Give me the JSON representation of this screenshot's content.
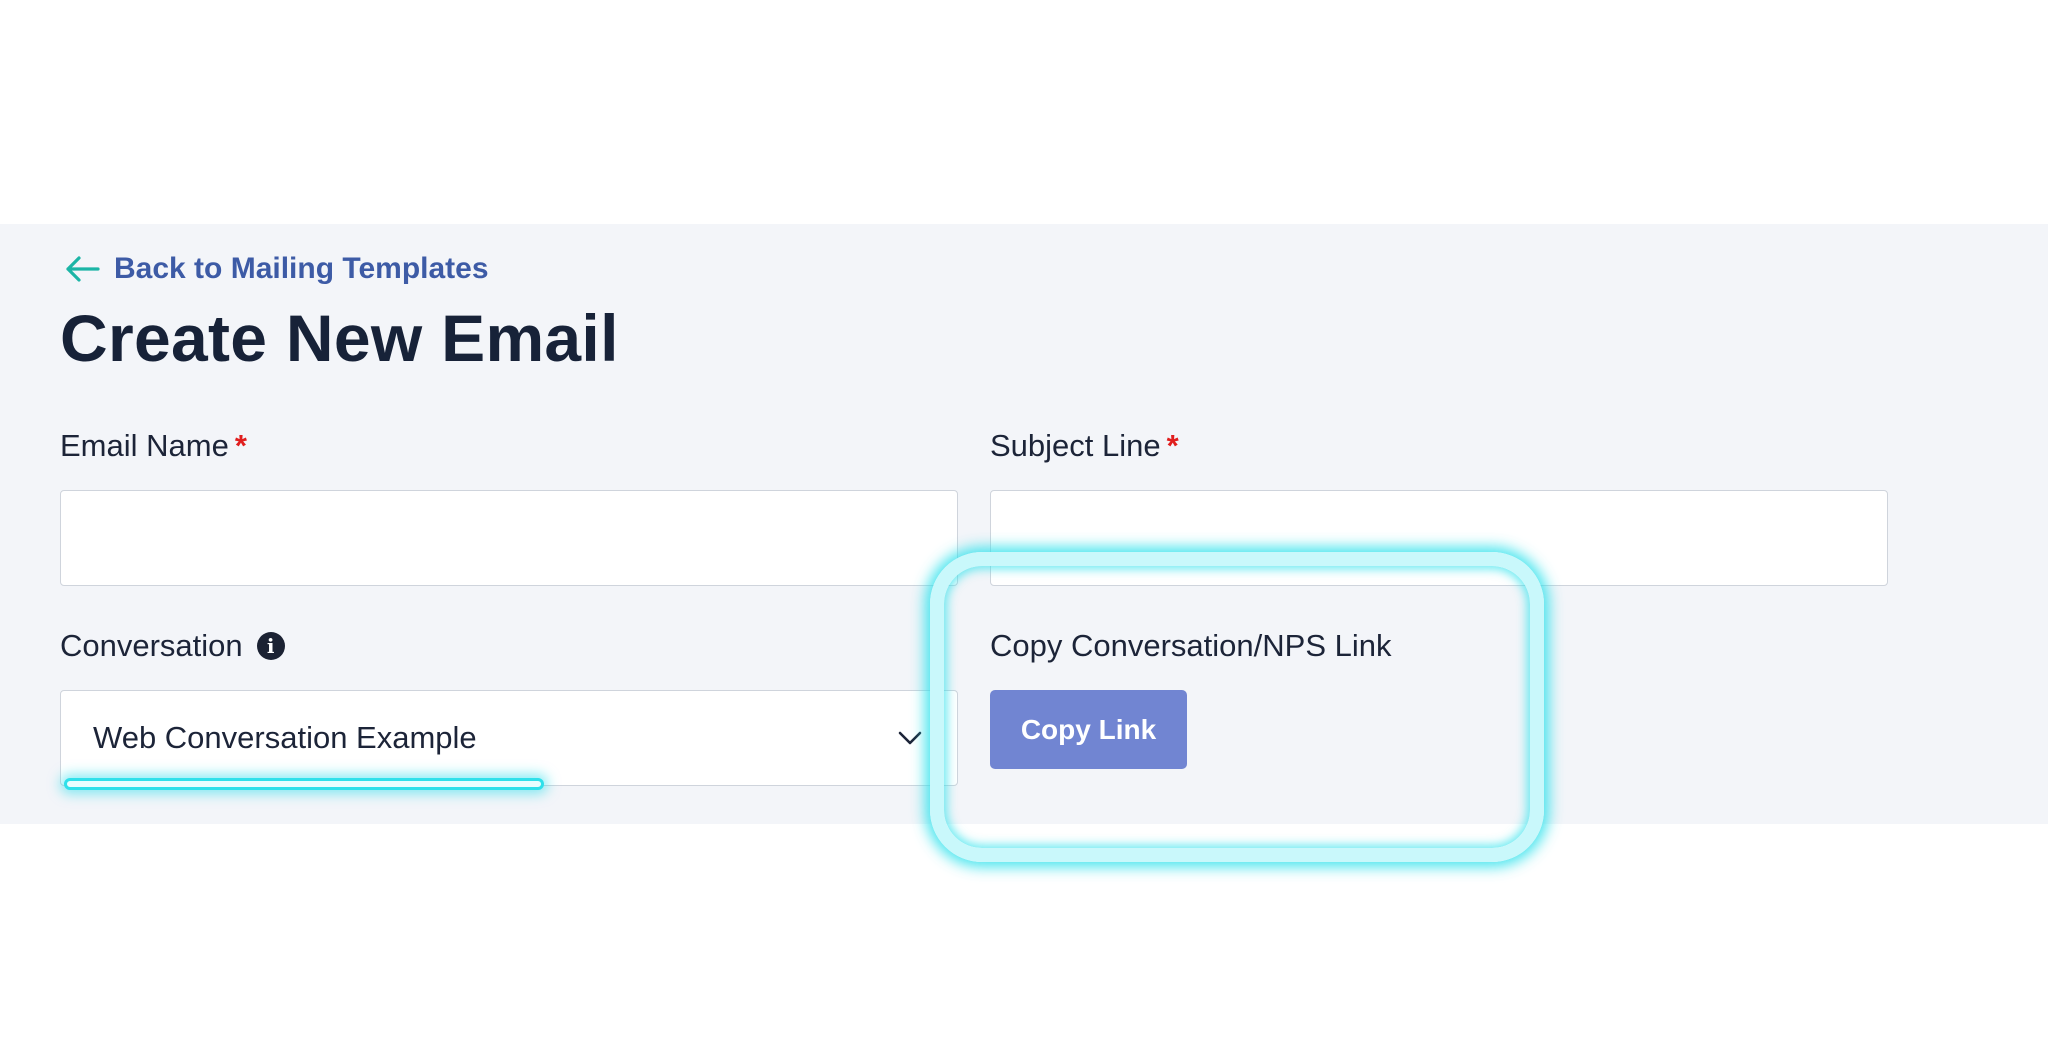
{
  "back_link": {
    "label": "Back to Mailing Templates"
  },
  "page_title": "Create New Email",
  "form": {
    "email_name": {
      "label": "Email Name",
      "required_marker": "*",
      "value": ""
    },
    "subject_line": {
      "label": "Subject Line",
      "required_marker": "*",
      "value": ""
    },
    "conversation": {
      "label": "Conversation",
      "selected": "Web Conversation Example"
    },
    "copy_link": {
      "label": "Copy Conversation/NPS Link",
      "button_label": "Copy Link"
    }
  },
  "colors": {
    "page_background": "#ffffff",
    "panel_background": "#f3f5f9",
    "link": "#3d5ba6",
    "arrow": "#1bb5a6",
    "title": "#172238",
    "required": "#e01e1e",
    "button": "#7185d2",
    "highlight": "#2fe0ea"
  }
}
